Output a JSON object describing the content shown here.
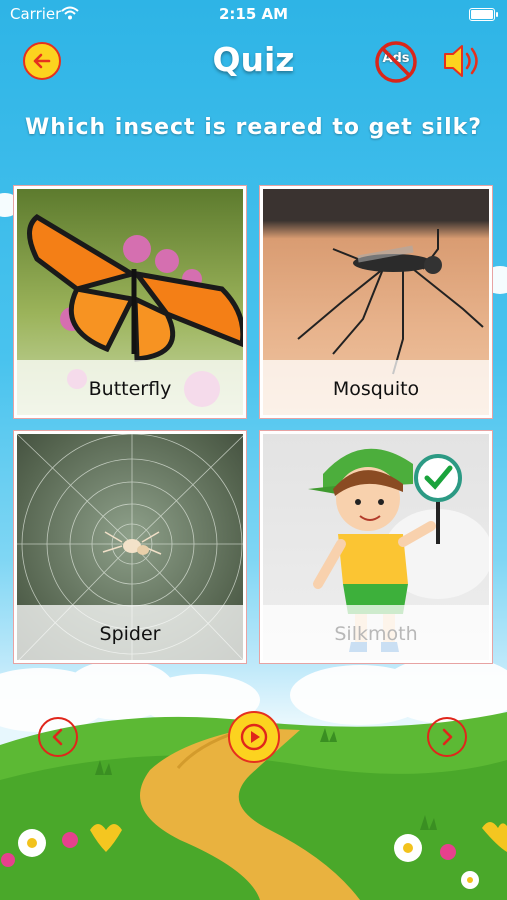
{
  "status_bar": {
    "carrier": "Carrier",
    "time": "2:15 AM"
  },
  "header": {
    "title": "Quiz",
    "back_icon": "arrow-left-icon",
    "no_ads_label": "Ads",
    "sound_icon": "speaker-icon"
  },
  "question": "Which insect is reared to get silk?",
  "options": [
    {
      "label": "Butterfly",
      "icon": "butterfly-picture"
    },
    {
      "label": "Mosquito",
      "icon": "mosquito-picture"
    },
    {
      "label": "Spider",
      "icon": "spider-picture"
    },
    {
      "label": "Silkmoth",
      "icon": "boy-with-checkmark-picture",
      "state": "correct"
    }
  ],
  "footer": {
    "prev_icon": "chevron-left-icon",
    "play_icon": "play-icon",
    "next_icon": "chevron-right-icon"
  },
  "colors": {
    "accent_yellow": "#fcd31f",
    "accent_red": "#e5301e",
    "sky": "#2eb4e6",
    "grass": "#4fae2f"
  }
}
